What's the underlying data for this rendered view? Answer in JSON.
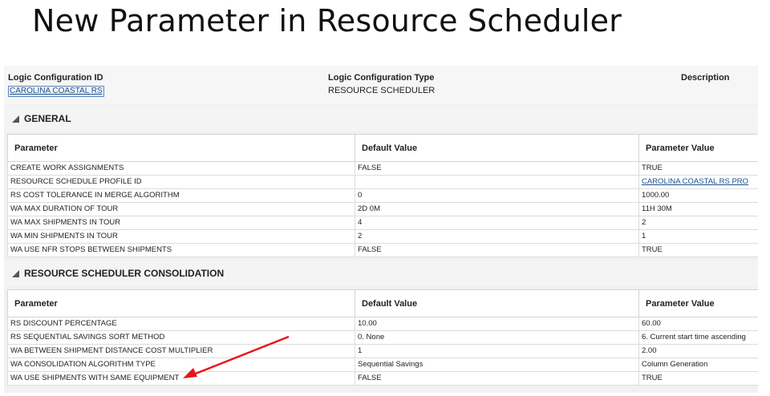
{
  "slide_title": "New Parameter in Resource Scheduler",
  "header": {
    "id_label": "Logic Configuration ID",
    "id_value": "CAROLINA COASTAL RS",
    "type_label": "Logic Configuration Type",
    "type_value": "RESOURCE SCHEDULER",
    "desc_label": "Description"
  },
  "sections": {
    "general": {
      "title": "GENERAL",
      "columns": [
        "Parameter",
        "Default Value",
        "Parameter Value"
      ],
      "rows": [
        [
          "CREATE WORK ASSIGNMENTS",
          "FALSE",
          "TRUE"
        ],
        [
          "RESOURCE SCHEDULE PROFILE ID",
          "",
          "CAROLINA COASTAL RS PRO"
        ],
        [
          "RS COST TOLERANCE IN MERGE ALGORITHM",
          "0",
          "1000.00"
        ],
        [
          "WA MAX DURATION OF TOUR",
          "2D 0M",
          "11H 30M"
        ],
        [
          "WA MAX SHIPMENTS IN TOUR",
          "4",
          "2"
        ],
        [
          "WA MIN SHIPMENTS IN TOUR",
          "2",
          "1"
        ],
        [
          "WA USE NFR STOPS BETWEEN SHIPMENTS",
          "FALSE",
          "TRUE"
        ]
      ]
    },
    "consolidation": {
      "title": "RESOURCE SCHEDULER CONSOLIDATION",
      "columns": [
        "Parameter",
        "Default Value",
        "Parameter Value"
      ],
      "rows": [
        [
          "RS DISCOUNT PERCENTAGE",
          "10.00",
          "60.00"
        ],
        [
          "RS SEQUENTIAL SAVINGS SORT METHOD",
          "0. None",
          "6. Current start time ascending"
        ],
        [
          "WA BETWEEN SHIPMENT DISTANCE COST MULTIPLIER",
          "1",
          "2.00"
        ],
        [
          "WA CONSOLIDATION ALGORITHM TYPE",
          "Sequential Savings",
          "Column Generation"
        ],
        [
          "WA USE SHIPMENTS WITH SAME EQUIPMENT",
          "FALSE",
          "TRUE"
        ]
      ]
    }
  },
  "colors": {
    "link": "#1a4f8f",
    "annotation_arrow": "#e8141a"
  }
}
